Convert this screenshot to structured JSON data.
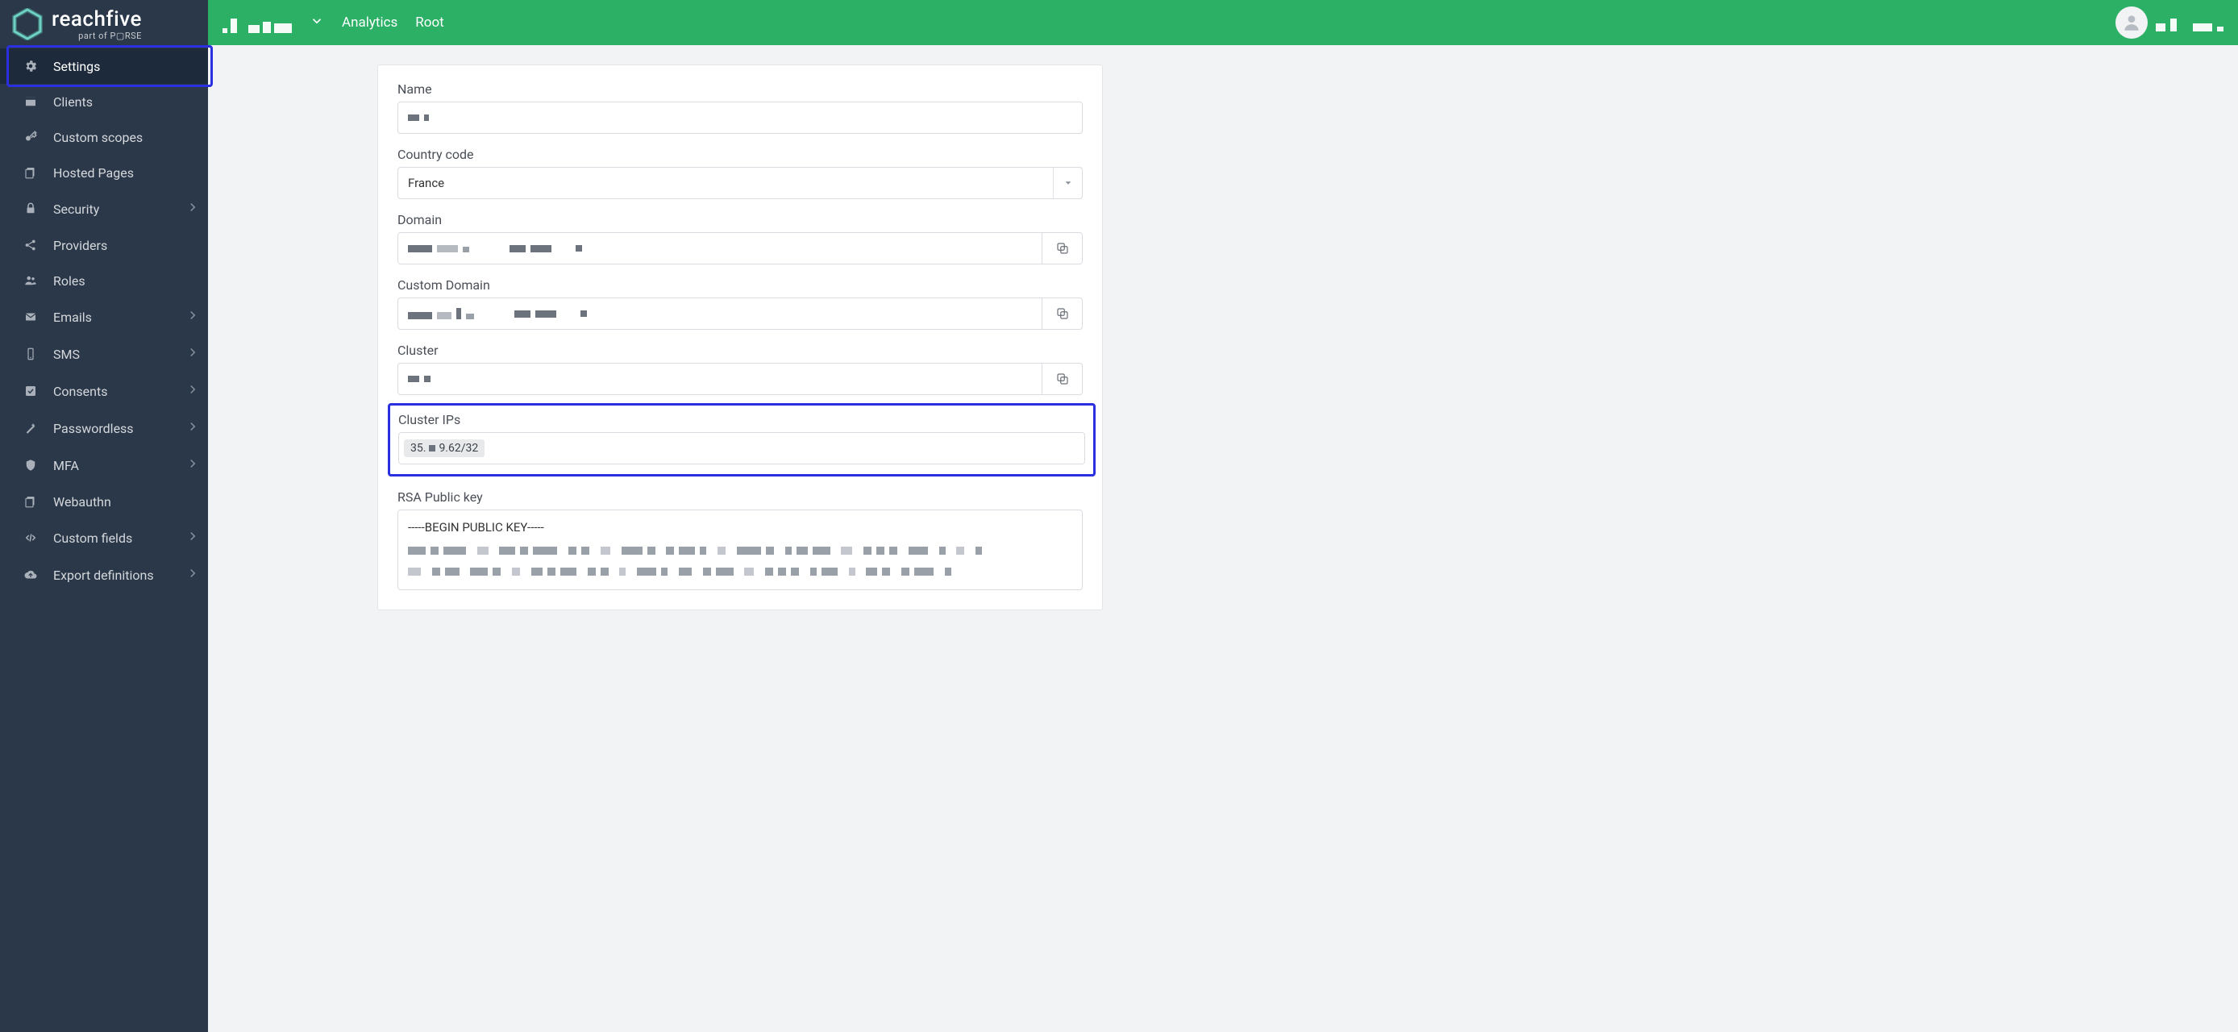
{
  "brand": {
    "name": "reachfive",
    "tagline": "part of P▢RSE"
  },
  "topnav": {
    "analytics": "Analytics",
    "root": "Root"
  },
  "sidebar": {
    "settings": "Settings",
    "clients": "Clients",
    "custom_scopes": "Custom scopes",
    "hosted_pages": "Hosted Pages",
    "security": "Security",
    "providers": "Providers",
    "roles": "Roles",
    "emails": "Emails",
    "sms": "SMS",
    "consents": "Consents",
    "passwordless": "Passwordless",
    "mfa": "MFA",
    "webauthn": "Webauthn",
    "custom_fields": "Custom fields",
    "export_definitions": "Export definitions"
  },
  "form": {
    "name_label": "Name",
    "name_value": "",
    "country_label": "Country code",
    "country_value": "France",
    "domain_label": "Domain",
    "domain_value": "",
    "custom_domain_label": "Custom Domain",
    "custom_domain_value": "",
    "cluster_label": "Cluster",
    "cluster_value": "",
    "cluster_ips_label": "Cluster IPs",
    "cluster_ips_tag_prefix": "35.",
    "cluster_ips_tag_suffix": "9.62/32",
    "rsa_label": "RSA Public key",
    "rsa_begin": "-----BEGIN PUBLIC KEY-----"
  }
}
